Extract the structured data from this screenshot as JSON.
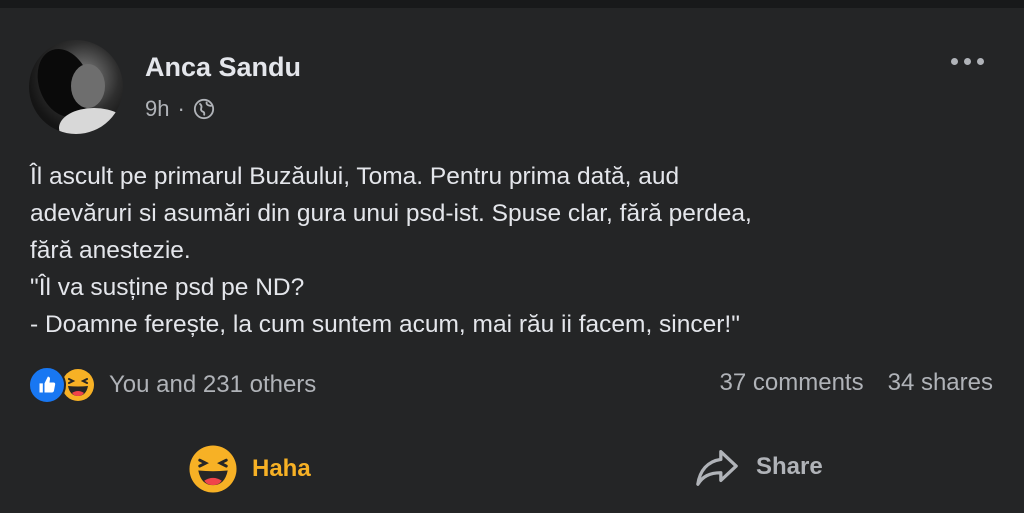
{
  "post": {
    "author": "Anca Sandu",
    "time": "9h",
    "separator": "·",
    "privacy_icon": "globe-icon",
    "more_icon": "more-options-icon",
    "text_lines": [
      "Îl ascult pe primarul Buzăului, Toma. Pentru prima dată, aud",
      "adevăruri si asumări din gura unui psd-ist. Spuse clar, fără perdea,",
      "fără anestezie.",
      "\"Îl va susține psd pe ND?",
      "- Doamne ferește, la cum suntem acum, mai rău ii facem, sincer!\""
    ]
  },
  "stats": {
    "reaction_icons": [
      "like-reaction-icon",
      "haha-reaction-icon"
    ],
    "reactions_text": "You and 231 others",
    "comments": "37 comments",
    "shares": "34 shares"
  },
  "actions": {
    "haha_label": "Haha",
    "share_label": "Share"
  },
  "colors": {
    "background": "#242526",
    "text": "#e4e6eb",
    "secondary": "#b0b3b8",
    "like_blue": "#1877f2",
    "haha_yellow": "#f7b125"
  }
}
